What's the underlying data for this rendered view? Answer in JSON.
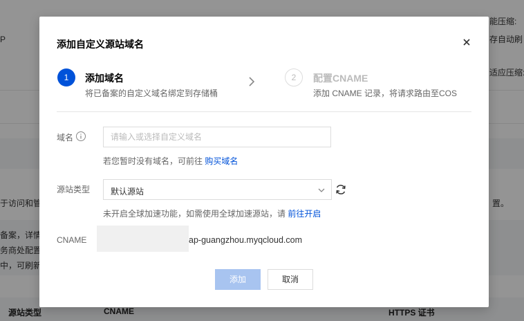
{
  "background": {
    "fragments": {
      "top_right_1": "能压缩:",
      "top_right_2": "存自动刷",
      "top_right_3": "适应压缩:",
      "left_1": "于访问和管",
      "left_2": "备案，详情见",
      "left_3": "务商处配置",
      "left_4": "中，可刷新",
      "right_mid": "置。",
      "left_top": "P"
    },
    "table_headers": {
      "origin_type": "源站类型",
      "cname": "CNAME",
      "https_cert": "HTTPS 证书"
    }
  },
  "modal": {
    "title": "添加自定义源站域名",
    "steps": [
      {
        "number": "1",
        "title": "添加域名",
        "desc": "将已备案的自定义域名绑定到存储桶"
      },
      {
        "number": "2",
        "title": "配置CNAME",
        "desc": "添加 CNAME 记录，将请求路由至COS"
      }
    ],
    "domain": {
      "label": "域名",
      "placeholder": "请输入或选择自定义域名",
      "hint_prefix": "若您暂时没有域名，可前往",
      "hint_link": "购买域名"
    },
    "origin_type": {
      "label": "源站类型",
      "selected": "默认源站",
      "hint_prefix": "未开启全球加速功能，如需使用全球加速源站，请",
      "hint_link": "前往开启"
    },
    "cname": {
      "label": "CNAME",
      "value": "ap-guangzhou.myqcloud.com"
    },
    "buttons": {
      "add": "添加",
      "cancel": "取消"
    }
  },
  "colors": {
    "primary": "#0052d9",
    "disabled_primary": "#a8c4f0",
    "overlay": "rgba(0,0,0,0.42)"
  }
}
